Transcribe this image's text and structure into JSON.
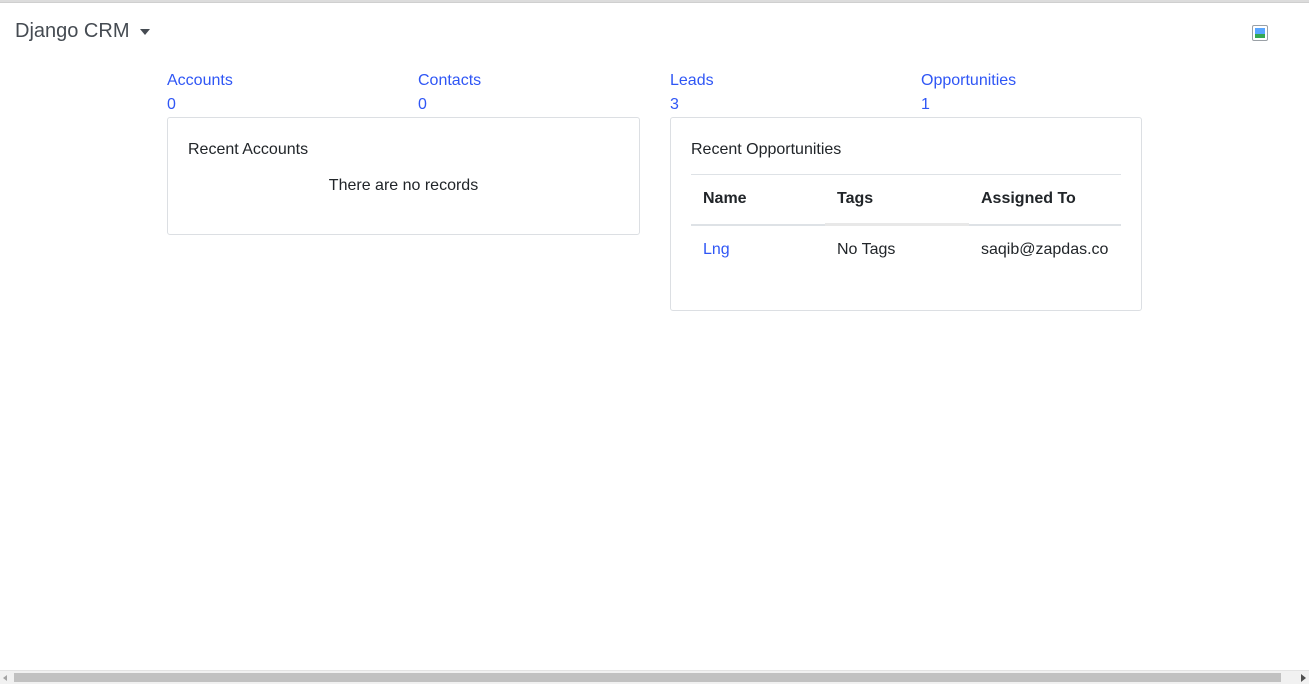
{
  "header": {
    "brand": "Django CRM",
    "brand_icon": "chevron-down-icon",
    "avatar_icon": "broken-image-icon"
  },
  "stats": [
    {
      "label": "Accounts",
      "count": "0"
    },
    {
      "label": "Contacts",
      "count": "0"
    },
    {
      "label": "Leads",
      "count": "3"
    },
    {
      "label": "Opportunities",
      "count": "1"
    }
  ],
  "recent_accounts": {
    "title": "Recent Accounts",
    "empty_message": "There are no records"
  },
  "recent_opportunities": {
    "title": "Recent Opportunities",
    "columns": [
      "Name",
      "Tags",
      "Assigned To"
    ],
    "rows": [
      {
        "name": "Lng",
        "tags": "No Tags",
        "assigned_to": "saqib@zapdas.co"
      }
    ]
  },
  "colors": {
    "link": "#2f56f5",
    "text": "#212529",
    "brand": "#454b52",
    "border": "#dcdfe3"
  }
}
